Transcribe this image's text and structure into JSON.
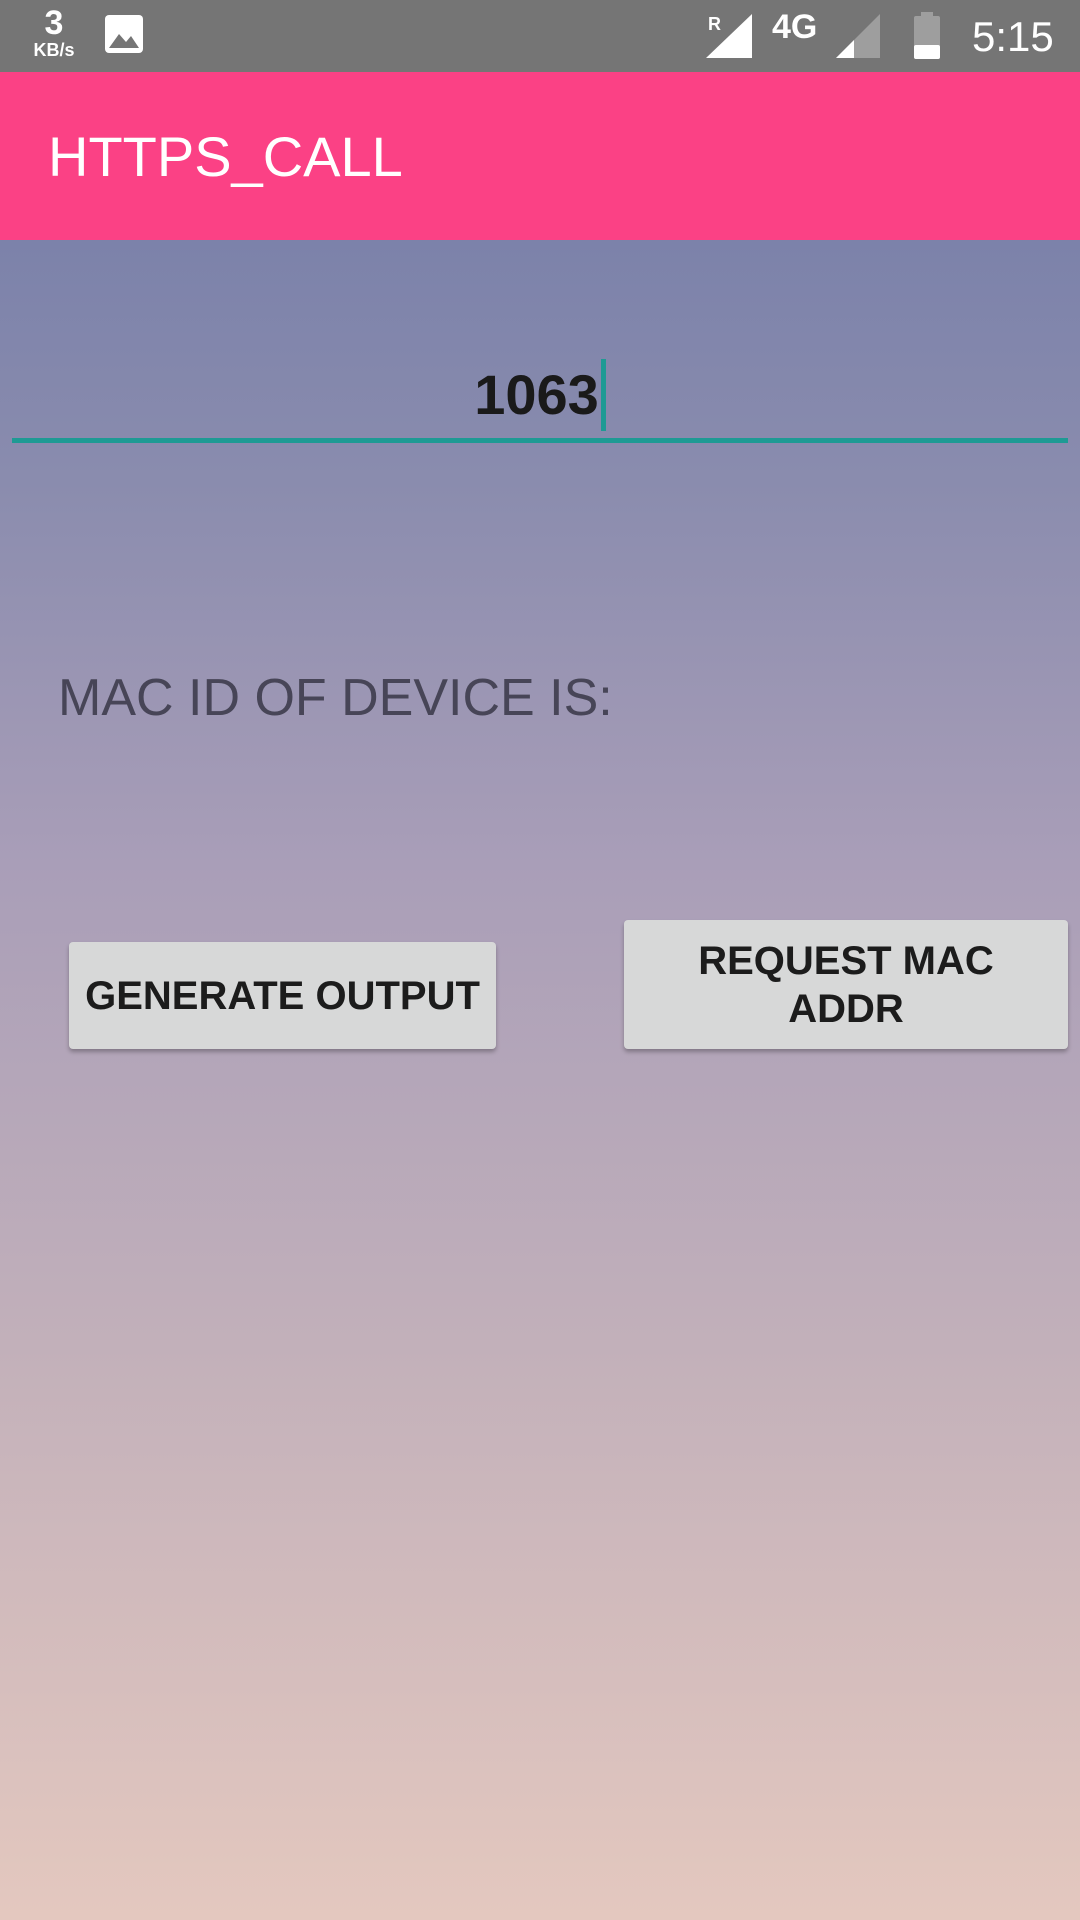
{
  "status_bar": {
    "net_speed_value": "3",
    "net_speed_unit": "KB/s",
    "roaming_indicator": "R",
    "network_type": "4G",
    "time": "5:15",
    "icons": [
      "gallery-icon",
      "roaming-signal-icon",
      "signal-icon",
      "battery-icon"
    ]
  },
  "app_bar": {
    "title": "HTTPS_CALL",
    "color": "#fb4185"
  },
  "input": {
    "value": "1063",
    "underline_color": "#1e9a94"
  },
  "mac_label": "MAC ID OF DEVICE IS:",
  "buttons": {
    "generate": "GENERATE OUTPUT",
    "request": "REQUEST MAC ADDR"
  }
}
